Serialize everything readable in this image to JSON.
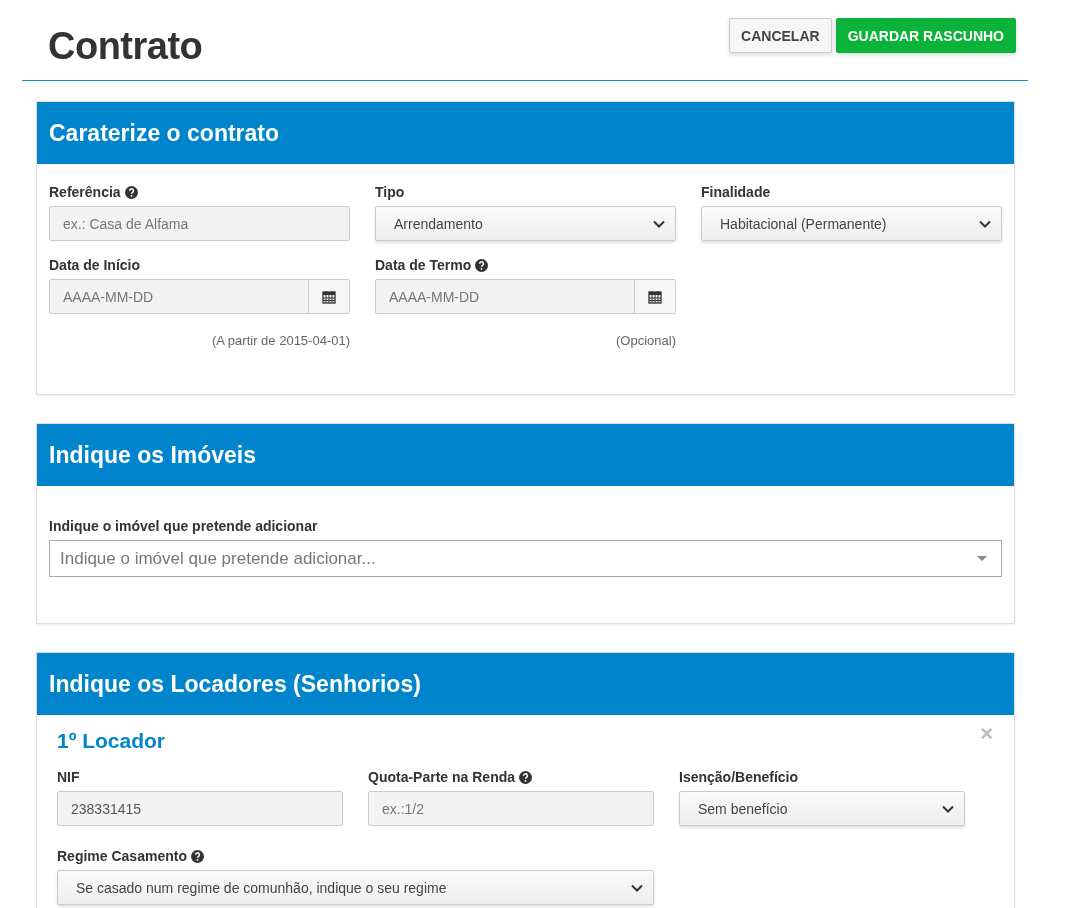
{
  "header": {
    "title": "Contrato",
    "buttons": [
      {
        "label": "CANCELAR",
        "kind": "default"
      },
      {
        "label": "GUARDAR RASCUNHO",
        "kind": "primary"
      }
    ]
  },
  "sections": [
    {
      "title": "Caraterize o contrato",
      "kind": "form",
      "rows": [
        [
          {
            "kind": "text",
            "label": "Referência",
            "help": true,
            "placeholder": "ex.: Casa de Alfama"
          },
          {
            "kind": "select",
            "label": "Tipo",
            "help": false,
            "value": "Arrendamento"
          },
          {
            "kind": "select",
            "label": "Finalidade",
            "help": false,
            "value": "Habitacional (Permanente)"
          }
        ],
        [
          {
            "kind": "date",
            "label": "Data de Início",
            "help": false,
            "placeholder": "AAAA-MM-DD",
            "hint": "(A partir de 2015-04-01)"
          },
          {
            "kind": "date",
            "label": "Data de Termo",
            "help": true,
            "placeholder": "AAAA-MM-DD",
            "hint": "(Opcional)"
          }
        ]
      ]
    },
    {
      "title": "Indique os Imóveis",
      "kind": "search",
      "label": "Indique o imóvel que pretende adicionar",
      "placeholder": "Indique o imóvel que pretende adicionar..."
    },
    {
      "title": "Indique os Locadores (Senhorios)",
      "kind": "people",
      "people": [
        {
          "title": "1º Locador",
          "close": "×",
          "rows": [
            [
              {
                "kind": "text",
                "label": "NIF",
                "help": false,
                "value": "238331415"
              },
              {
                "kind": "text",
                "label": "Quota-Parte na Renda",
                "help": true,
                "placeholder": "ex.:1/2"
              },
              {
                "kind": "select",
                "label": "Isenção/Benefício",
                "help": false,
                "value": "Sem benefício"
              }
            ],
            [
              {
                "kind": "select",
                "label": "Regime Casamento",
                "help": true,
                "value": "Se casado num regime de comunhão, indique o seu regime"
              }
            ]
          ]
        }
      ]
    }
  ]
}
